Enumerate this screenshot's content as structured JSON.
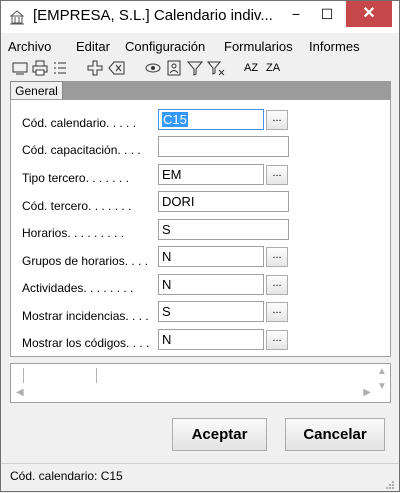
{
  "window": {
    "title": "[EMPRESA, S.L.] Calendario indiv..."
  },
  "titlebar_buttons": {
    "minimize": "−",
    "maximize": "☐",
    "close": "✕"
  },
  "menu": [
    "Archivo",
    "Editar",
    "Configuración",
    "Formularios",
    "Informes"
  ],
  "toolbar_icons": [
    "monitor-icon",
    "printer-icon",
    "list-icon",
    "add-icon",
    "delete-icon",
    "view-icon",
    "card-icon",
    "filter-icon",
    "clear-filter-icon",
    "sort-asc-icon",
    "sort-desc-icon"
  ],
  "toolbar_text": {
    "sort_asc": "AZ",
    "sort_desc": "ZA"
  },
  "tabs": {
    "general": "General"
  },
  "form": {
    "fields": [
      {
        "label": "Cód. calendario. . . . .",
        "value": "C15"
      },
      {
        "label": "Cód. capacitación. . . .",
        "value": ""
      },
      {
        "label": "Tipo tercero. . . . . . .",
        "value": "EM"
      },
      {
        "label": "Cód. tercero. . . . . . .",
        "value": "DORI"
      },
      {
        "label": "Horarios. . . . . . . . .",
        "value": "S"
      },
      {
        "label": "Grupos de horarios. . . .",
        "value": "N"
      },
      {
        "label": "Actividades. . . . . . . .",
        "value": "N"
      },
      {
        "label": "Mostrar incidencias. . . .",
        "value": "S"
      },
      {
        "label": "Mostrar los códigos. . . .",
        "value": "N"
      }
    ],
    "lookup_label": "..."
  },
  "buttons": {
    "accept": "Aceptar",
    "cancel": "Cancelar"
  },
  "status": {
    "text": "Cód. calendario: C15"
  },
  "colors": {
    "close": "#c7484a",
    "selection": "#3399ff",
    "focus_border": "#4a90e2"
  }
}
